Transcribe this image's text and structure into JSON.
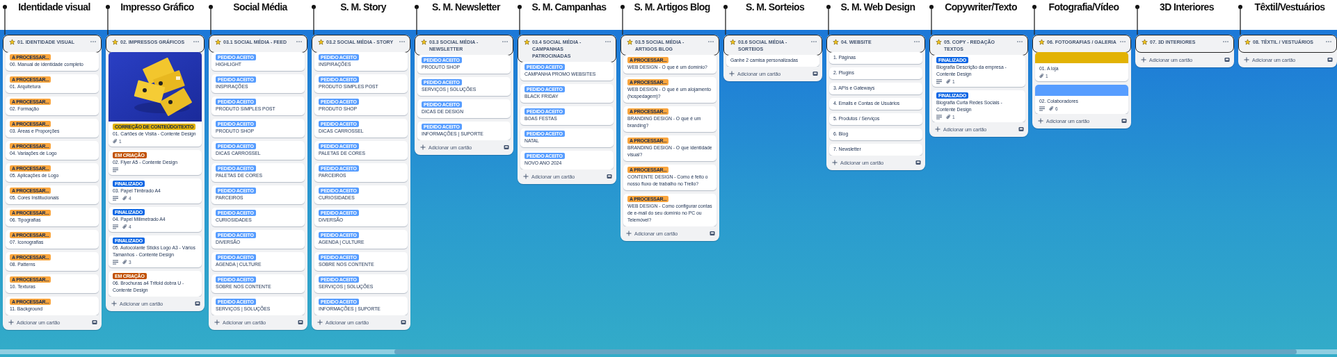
{
  "lists": [
    {
      "annotation": "Identidade visual",
      "title": "01. IDENTIDADE VISUAL",
      "add_card": "Adicionar um cartão",
      "cards": [
        {
          "labels": [
            {
              "text": "A PROCESSAR...",
              "color": "#faa53d"
            }
          ],
          "title": "00. Manual de identidade completo"
        },
        {
          "labels": [
            {
              "text": "A PROCESSAR...",
              "color": "#faa53d"
            }
          ],
          "title": "01. Arquitetura"
        },
        {
          "labels": [
            {
              "text": "A PROCESSAR...",
              "color": "#faa53d"
            }
          ],
          "title": "02. Formação"
        },
        {
          "labels": [
            {
              "text": "A PROCESSAR...",
              "color": "#faa53d"
            }
          ],
          "title": "03. Áreas e Proporções"
        },
        {
          "labels": [
            {
              "text": "A PROCESSAR...",
              "color": "#faa53d"
            }
          ],
          "title": "04. Variações de Logo"
        },
        {
          "labels": [
            {
              "text": "A PROCESSAR...",
              "color": "#faa53d"
            }
          ],
          "title": "05. Aplicações de Logo"
        },
        {
          "labels": [
            {
              "text": "A PROCESSAR...",
              "color": "#faa53d"
            }
          ],
          "title": "05. Cores Institucionais"
        },
        {
          "labels": [
            {
              "text": "A PROCESSAR...",
              "color": "#faa53d"
            }
          ],
          "title": "06. Tipografias"
        },
        {
          "labels": [
            {
              "text": "A PROCESSAR...",
              "color": "#faa53d"
            }
          ],
          "title": "07. Iconografias"
        },
        {
          "labels": [
            {
              "text": "A PROCESSAR...",
              "color": "#faa53d"
            }
          ],
          "title": "08. Patterns"
        },
        {
          "labels": [
            {
              "text": "A PROCESSAR...",
              "color": "#faa53d"
            }
          ],
          "title": "10. Texturas"
        },
        {
          "labels": [
            {
              "text": "A PROCESSAR...",
              "color": "#faa53d"
            }
          ],
          "title": "11. Background"
        }
      ]
    },
    {
      "annotation": "Impresso Gráfico",
      "title": "02. IMPRESSOS GRÁFICOS",
      "add_card": "Adicionar um cartão",
      "cards": [
        {
          "cover": {
            "kind": "picture"
          },
          "labels": [
            {
              "text": "CORREÇÃO DE CONTEÚDO/TEXTO",
              "color": "#e2b203"
            }
          ],
          "title": "01. Cartões de Visita - Contente Design",
          "badges": [
            {
              "kind": "attachments",
              "count": "1"
            }
          ]
        },
        {
          "labels": [
            {
              "text": "EM CRIAÇÃO",
              "color": "#c25100"
            }
          ],
          "title": "02. Flyer A5 - Contente Design",
          "badges": [
            {
              "kind": "description"
            }
          ]
        },
        {
          "labels": [
            {
              "text": "FINALIZADO",
              "color": "#0c66e4"
            }
          ],
          "title": "03. Papel Timbrado A4",
          "badges": [
            {
              "kind": "description"
            },
            {
              "kind": "attachments",
              "count": "4"
            }
          ]
        },
        {
          "labels": [
            {
              "text": "FINALIZADO",
              "color": "#0c66e4"
            }
          ],
          "title": "04. Papel Milimetrado A4",
          "badges": [
            {
              "kind": "description"
            },
            {
              "kind": "attachments",
              "count": "4"
            }
          ]
        },
        {
          "labels": [
            {
              "text": "FINALIZADO",
              "color": "#0c66e4"
            }
          ],
          "title": "05. Autocolante Sticks Logo A3 - Vários Tamanhos - Contente Design",
          "badges": [
            {
              "kind": "description"
            },
            {
              "kind": "attachments",
              "count": "3"
            }
          ]
        },
        {
          "labels": [
            {
              "text": "EM CRIAÇÃO",
              "color": "#c25100"
            }
          ],
          "title": "06. Brochuras a4 Trifold dobra U - Contente Design"
        }
      ]
    },
    {
      "annotation": "Social Média",
      "title": "03.1 SOCIAL MÉDIA - FEED",
      "add_card": "Adicionar um cartão",
      "cards": [
        {
          "labels": [
            {
              "text": "PEDIDO ACEITO",
              "color": "#579dff"
            }
          ],
          "title": "HIGHLIGHT"
        },
        {
          "labels": [
            {
              "text": "PEDIDO ACEITO",
              "color": "#579dff"
            }
          ],
          "title": "INSPIRAÇÕES"
        },
        {
          "labels": [
            {
              "text": "PEDIDO ACEITO",
              "color": "#579dff"
            }
          ],
          "title": "PRODUTO SIMPLES POST"
        },
        {
          "labels": [
            {
              "text": "PEDIDO ACEITO",
              "color": "#579dff"
            }
          ],
          "title": "PRODUTO SHOP"
        },
        {
          "labels": [
            {
              "text": "PEDIDO ACEITO",
              "color": "#579dff"
            }
          ],
          "title": "DICAS CARROSSEL"
        },
        {
          "labels": [
            {
              "text": "PEDIDO ACEITO",
              "color": "#579dff"
            }
          ],
          "title": "PALETAS DE CORES"
        },
        {
          "labels": [
            {
              "text": "PEDIDO ACEITO",
              "color": "#579dff"
            }
          ],
          "title": "PARCEIROS"
        },
        {
          "labels": [
            {
              "text": "PEDIDO ACEITO",
              "color": "#579dff"
            }
          ],
          "title": "CURIOSIDADES"
        },
        {
          "labels": [
            {
              "text": "PEDIDO ACEITO",
              "color": "#579dff"
            }
          ],
          "title": "DIVERSÃO"
        },
        {
          "labels": [
            {
              "text": "PEDIDO ACEITO",
              "color": "#579dff"
            }
          ],
          "title": "AGENDA | CULTURE"
        },
        {
          "labels": [
            {
              "text": "PEDIDO ACEITO",
              "color": "#579dff"
            }
          ],
          "title": "SOBRE NOS CONTENTE"
        },
        {
          "labels": [
            {
              "text": "PEDIDO ACEITO",
              "color": "#579dff"
            }
          ],
          "title": "SERVIÇOS | SOLUÇÕES"
        }
      ]
    },
    {
      "annotation": "S. M. Story",
      "title": "03.2 SOCIAL MÉDIA - STORY",
      "add_card": "Adicionar um cartão",
      "cards": [
        {
          "labels": [
            {
              "text": "PEDIDO ACEITO",
              "color": "#579dff"
            }
          ],
          "title": "INSPIRAÇÕES"
        },
        {
          "labels": [
            {
              "text": "PEDIDO ACEITO",
              "color": "#579dff"
            }
          ],
          "title": "PRODUTO SIMPLES POST"
        },
        {
          "labels": [
            {
              "text": "PEDIDO ACEITO",
              "color": "#579dff"
            }
          ],
          "title": "PRODUTO SHOP"
        },
        {
          "labels": [
            {
              "text": "PEDIDO ACEITO",
              "color": "#579dff"
            }
          ],
          "title": "DICAS CARROSSEL"
        },
        {
          "labels": [
            {
              "text": "PEDIDO ACEITO",
              "color": "#579dff"
            }
          ],
          "title": "PALETAS DE CORES"
        },
        {
          "labels": [
            {
              "text": "PEDIDO ACEITO",
              "color": "#579dff"
            }
          ],
          "title": "PARCEIROS"
        },
        {
          "labels": [
            {
              "text": "PEDIDO ACEITO",
              "color": "#579dff"
            }
          ],
          "title": "CURIOSIDADES"
        },
        {
          "labels": [
            {
              "text": "PEDIDO ACEITO",
              "color": "#579dff"
            }
          ],
          "title": "DIVERSÃO"
        },
        {
          "labels": [
            {
              "text": "PEDIDO ACEITO",
              "color": "#579dff"
            }
          ],
          "title": "AGENDA | CULTURE"
        },
        {
          "labels": [
            {
              "text": "PEDIDO ACEITO",
              "color": "#579dff"
            }
          ],
          "title": "SOBRE NOS CONTENTE"
        },
        {
          "labels": [
            {
              "text": "PEDIDO ACEITO",
              "color": "#579dff"
            }
          ],
          "title": "SERVIÇOS | SOLUÇÕES"
        },
        {
          "labels": [
            {
              "text": "PEDIDO ACEITO",
              "color": "#579dff"
            }
          ],
          "title": "INFORMAÇÕES | SUPORTE"
        }
      ]
    },
    {
      "annotation": "S. M. Newsletter",
      "title": "03.3 SOCIAL MÉDIA - NEWSLETTER",
      "add_card": "Adicionar um cartão",
      "cards": [
        {
          "labels": [
            {
              "text": "PEDIDO ACEITO",
              "color": "#579dff"
            }
          ],
          "title": "PRODUTO SHOP"
        },
        {
          "labels": [
            {
              "text": "PEDIDO ACEITO",
              "color": "#579dff"
            }
          ],
          "title": "SERVIÇOS | SOLUÇÕES"
        },
        {
          "labels": [
            {
              "text": "PEDIDO ACEITO",
              "color": "#579dff"
            }
          ],
          "title": "DICAS DE DESIGN"
        },
        {
          "labels": [
            {
              "text": "PEDIDO ACEITO",
              "color": "#579dff"
            }
          ],
          "title": "INFORMAÇÕES | SUPORTE"
        }
      ]
    },
    {
      "annotation": "S. M. Campanhas",
      "title": "03.4 SOCIAL MÉDIA - CAMPANHAS PATROCINADAS",
      "add_card": "Adicionar um cartão",
      "cards": [
        {
          "labels": [
            {
              "text": "PEDIDO ACEITO",
              "color": "#579dff"
            }
          ],
          "title": "CAMPANHA PROMO WEBSITES"
        },
        {
          "labels": [
            {
              "text": "PEDIDO ACEITO",
              "color": "#579dff"
            }
          ],
          "title": "BLACK FRIDAY"
        },
        {
          "labels": [
            {
              "text": "PEDIDO ACEITO",
              "color": "#579dff"
            }
          ],
          "title": "BOAS FESTAS"
        },
        {
          "labels": [
            {
              "text": "PEDIDO ACEITO",
              "color": "#579dff"
            }
          ],
          "title": "NATAL"
        },
        {
          "labels": [
            {
              "text": "PEDIDO ACEITO",
              "color": "#579dff"
            }
          ],
          "title": "NOVO ANO 2024"
        }
      ]
    },
    {
      "annotation": "S. M. Artigos Blog",
      "title": "03.5 SOCIAL MÉDIA - ARTIGOS BLOG",
      "add_card": "Adicionar um cartão",
      "cards": [
        {
          "labels": [
            {
              "text": "A PROCESSAR...",
              "color": "#faa53d"
            }
          ],
          "title": "WEB DESIGN - O que é um domínio?"
        },
        {
          "labels": [
            {
              "text": "A PROCESSAR...",
              "color": "#faa53d"
            }
          ],
          "title": "WEB DESIGN - O que é um alojamento (hospedagem)?"
        },
        {
          "labels": [
            {
              "text": "A PROCESSAR...",
              "color": "#faa53d"
            }
          ],
          "title": "BRANDING DESIGN - O que é um branding?"
        },
        {
          "labels": [
            {
              "text": "A PROCESSAR...",
              "color": "#faa53d"
            }
          ],
          "title": "BRANDING DESIGN - O que identidade visual?"
        },
        {
          "labels": [
            {
              "text": "A PROCESSAR...",
              "color": "#faa53d"
            }
          ],
          "title": "CONTENTE DESIGN - Como é feito o nosso fluxo de trabalho no Trello?"
        },
        {
          "labels": [
            {
              "text": "A PROCESSAR...",
              "color": "#faa53d"
            }
          ],
          "title": "WEB DESIGN - Como configurar contas de e-mail do seu domínio no PC ou Telemóvel?"
        }
      ]
    },
    {
      "annotation": "S. M. Sorteios",
      "title": "03.6 SOCIAL MÉDIA - SORTEIOS",
      "add_card": "Adicionar um cartão",
      "cards": [
        {
          "title": "Ganhe 2 camisa personalizadas"
        }
      ]
    },
    {
      "annotation": "S. M. Web Design",
      "title": "04. WEBSITE",
      "add_card": "Adicionar um cartão",
      "cards": [
        {
          "title": "1. Páginas"
        },
        {
          "title": "2. Plugins"
        },
        {
          "title": "3. APIs e Gateways"
        },
        {
          "title": "4. Emails e Contas de Usuários"
        },
        {
          "title": "5. Produtos / Serviços"
        },
        {
          "title": "6. Blog"
        },
        {
          "title": "7. Newsletter"
        }
      ]
    },
    {
      "annotation": "Copywriter/Texto",
      "title": "05. COPY - REDAÇÃO TEXTOS",
      "add_card": "Adicionar um cartão",
      "cards": [
        {
          "labels": [
            {
              "text": "FINALIZADO",
              "color": "#0c66e4"
            }
          ],
          "title": "Biografia Descrição da empresa - Contente Design",
          "badges": [
            {
              "kind": "description"
            },
            {
              "kind": "attachments",
              "count": "1"
            }
          ]
        },
        {
          "labels": [
            {
              "text": "FINALIZADO",
              "color": "#0c66e4"
            }
          ],
          "title": "Biografia Curta Redes Sociais - Contente Design",
          "badges": [
            {
              "kind": "description"
            },
            {
              "kind": "attachments",
              "count": "1"
            }
          ]
        }
      ]
    },
    {
      "annotation": "Fotografia/Vídeo",
      "title": "06. FOTOGRAFIAS / GALERIA",
      "add_card": "Adicionar um cartão",
      "cards": [
        {
          "cover": {
            "kind": "color",
            "color": "#e2b203"
          },
          "title": "01. A loja",
          "badges": [
            {
              "kind": "attachments",
              "count": "1"
            }
          ]
        },
        {
          "cover": {
            "kind": "color",
            "color": "#579dff"
          },
          "title": "02. Colaboradores",
          "badges": [
            {
              "kind": "description"
            },
            {
              "kind": "attachments",
              "count": "6"
            }
          ]
        }
      ]
    },
    {
      "annotation": "3D Interiores",
      "title": "07. 3D INTERIORES",
      "add_card": "Adicionar um cartão"
    },
    {
      "annotation": "Têxtil/Vestuários",
      "title": "08. TÊXTIL / VESTUÁRIOS",
      "add_card": "Adicionar um cartão"
    }
  ]
}
